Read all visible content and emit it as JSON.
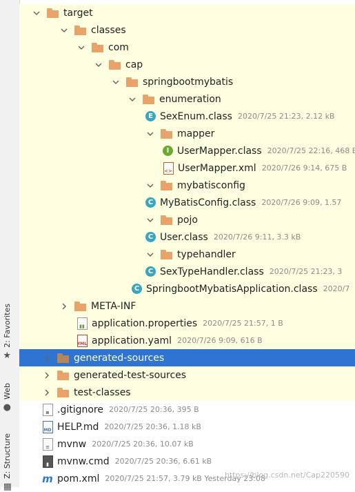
{
  "side_tabs": {
    "favorites": "2: Favorites",
    "web": "Web",
    "structure": "Z: Structure"
  },
  "tree": [
    {
      "label": "target",
      "type": "folder",
      "state": "expanded",
      "meta": ""
    },
    {
      "label": "classes",
      "type": "folder",
      "state": "expanded",
      "meta": ""
    },
    {
      "label": "com",
      "type": "folder",
      "state": "expanded",
      "meta": ""
    },
    {
      "label": "cap",
      "type": "folder",
      "state": "expanded",
      "meta": ""
    },
    {
      "label": "springbootmybatis",
      "type": "folder",
      "state": "expanded",
      "meta": ""
    },
    {
      "label": "enumeration",
      "type": "folder",
      "state": "expanded",
      "meta": ""
    },
    {
      "label": "SexEnum.class",
      "type": "enum-class",
      "meta": "2020/7/25 21:23, 2.12 kB"
    },
    {
      "label": "mapper",
      "type": "folder",
      "state": "expanded",
      "meta": ""
    },
    {
      "label": "UserMapper.class",
      "type": "interface-class",
      "meta": "2020/7/25 22:16, 468 B"
    },
    {
      "label": "UserMapper.xml",
      "type": "xml",
      "meta": "2020/7/26 9:14, 675 B"
    },
    {
      "label": "mybatisconfig",
      "type": "folder",
      "state": "expanded",
      "meta": ""
    },
    {
      "label": "MyBatisConfig.class",
      "type": "class",
      "meta": "2020/7/26 9:09, 1.57"
    },
    {
      "label": "pojo",
      "type": "folder",
      "state": "expanded",
      "meta": ""
    },
    {
      "label": "User.class",
      "type": "class",
      "meta": "2020/7/26 9:11, 3.3 kB"
    },
    {
      "label": "typehandler",
      "type": "folder",
      "state": "expanded",
      "meta": ""
    },
    {
      "label": "SexTypeHandler.class",
      "type": "class",
      "meta": "2020/7/25 21:23, 3"
    },
    {
      "label": "SpringbootMybatisApplication.class",
      "type": "app-class",
      "meta": "2020/7"
    },
    {
      "label": "META-INF",
      "type": "folder",
      "state": "collapsed",
      "meta": ""
    },
    {
      "label": "application.properties",
      "type": "properties",
      "meta": "2020/7/25 21:57, 1 B"
    },
    {
      "label": "application.yaml",
      "type": "yaml",
      "meta": "2020/7/26 9:09, 616 B"
    },
    {
      "label": "generated-sources",
      "type": "folder",
      "state": "collapsed",
      "meta": ""
    },
    {
      "label": "generated-test-sources",
      "type": "folder",
      "state": "collapsed",
      "meta": ""
    },
    {
      "label": "test-classes",
      "type": "folder",
      "state": "collapsed",
      "meta": ""
    },
    {
      "label": ".gitignore",
      "type": "gitignore",
      "meta": "2020/7/25 20:36, 395 B"
    },
    {
      "label": "HELP.md",
      "type": "md",
      "meta": "2020/7/25 20:36, 1.18 kB"
    },
    {
      "label": "mvnw",
      "type": "text",
      "meta": "2020/7/25 20:36, 10.07 kB"
    },
    {
      "label": "mvnw.cmd",
      "type": "cmd",
      "meta": "2020/7/25 20:36, 6.61 kB"
    },
    {
      "label": "pom.xml",
      "type": "maven",
      "meta": "2020/7/25 21:57, 3.79 kB Yesterday 23:08"
    }
  ],
  "selected_row": 20,
  "watermark": "https://blog.csdn.net/Cap220590",
  "colors": {
    "excluded_bg": "#fefee0",
    "selection": "#2f74d0",
    "folder": "#e9a36a",
    "class_badge": "#3aa4c4",
    "interface_badge": "#6aa830"
  }
}
